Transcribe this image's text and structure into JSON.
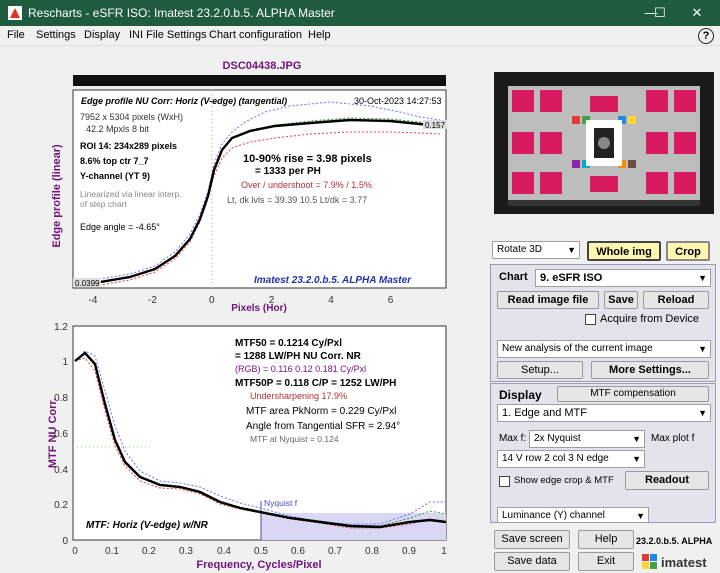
{
  "window": {
    "title": "Rescharts - eSFR ISO:  Imatest 23.2.0.b.5. ALPHA  Master",
    "minimize": "—",
    "maximize": "☐",
    "close": "✕"
  },
  "menu": [
    "File",
    "Settings",
    "Display",
    "INI File Settings",
    "Chart configuration",
    "Help"
  ],
  "plot1": {
    "filename": "DSC04438.JPG",
    "heading": "Edge profile  NU Corr: Horiz (V-edge) (tangential)",
    "date": "30-Oct-2023 14:27:53",
    "info": [
      "7952 x 5304 pixels (WxH)",
      "42.2 Mpxls   8 bit"
    ],
    "roi": [
      "ROI 14:  234x289 pixels",
      "8.6% top ctr  7_7",
      "Y-channel  (YT 9)"
    ],
    "lin": [
      "Linearized via linear interp.",
      "of step chart"
    ],
    "angle": "Edge angle = -4.65°",
    "rise1": "10-90% rise = 3.98 pixels",
    "rise2": "=  1333 per PH",
    "over": "Over / undershoot =  7.9% /  1.5%",
    "ldk": "Lt, dk lvls = 39.39  10.5  Lt/dk = 3.77",
    "brand": "Imatest 23.2.0.b.5. ALPHA Master",
    "ylabel": "Edge profile (linear)",
    "xlabel": "Pixels (Hor)",
    "v_hi": "0.157",
    "v_lo": "0.0399",
    "xticks": [
      "-4",
      "-2",
      "0",
      "2",
      "4",
      "6"
    ]
  },
  "plot2": {
    "mtf50": "MTF50 = 0.1214 Cy/Pxl",
    "lwph": "= 1288 LW/PH  NU Corr.  NR",
    "rgb": "(RGB) = 0.116  0.12  0.181 Cy/Pxl",
    "mtf50p": "MTF50P = 0.118 C/P = 1252 LW/PH",
    "under": "Undersharpening 17.9%",
    "area": "MTF area PkNorm = 0.229 Cy/Pxl",
    "anglesfr": "Angle from Tangential SFR = 2.94°",
    "nyq": "MTF at Nyquist = 0.124",
    "nyqlabel": "Nyquist f",
    "caption": "MTF: Horiz (V-edge) w/NR",
    "ylabel": "MTF  NU Corr.",
    "xlabel": "Frequency, Cycles/Pixel",
    "yticks": [
      "0",
      "0.2",
      "0.4",
      "0.6",
      "0.8",
      "1",
      "1.2"
    ],
    "xticks": [
      "0",
      "0.1",
      "0.2",
      "0.3",
      "0.4",
      "0.5",
      "0.6",
      "0.7",
      "0.8",
      "0.9",
      "1"
    ]
  },
  "panel": {
    "rotate": "Rotate 3D",
    "whole": "Whole img",
    "crop": "Crop",
    "chart_label": "Chart",
    "chart_value": "9. eSFR ISO",
    "read": "Read image file",
    "save": "Save",
    "reload": "Reload",
    "acquire": "Acquire from Device",
    "analysis": "New analysis of the current image",
    "setup": "Setup...",
    "more": "More Settings...",
    "display_label": "Display",
    "mtfcomp": "MTF compensation",
    "display_value": "1. Edge and MTF",
    "maxf_label": "Max f:",
    "maxf_value": "2x Nyquist",
    "maxplot": "Max plot f",
    "row_value": "14  V row 2 col 3 N edge",
    "show_crop": "Show edge crop & MTF",
    "readout": "Readout",
    "channel": "Luminance (Y) channel",
    "save_screen": "Save screen",
    "help": "Help",
    "version": "23.2.0.b.5. ALPHA",
    "save_data": "Save data",
    "exit": "Exit",
    "logo": "imatest"
  }
}
